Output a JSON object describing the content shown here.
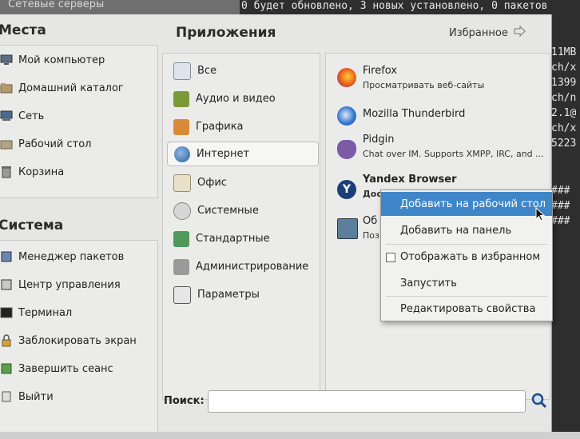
{
  "background": {
    "top_window_title": "Сетевые серверы",
    "terminal_top_line": "0 будет обновлено, 3 новых установлено, 0 пакетов",
    "terminal_right_lines": [
      "11MB",
      "ch/x",
      "1399",
      "ch/n",
      "2.1@",
      "ch/x",
      "5223"
    ],
    "terminal_hash_lines": [
      "###",
      "###",
      "###"
    ]
  },
  "places": {
    "heading": "Места",
    "items": [
      {
        "label": "Мой компьютер",
        "icon": "computer-icon"
      },
      {
        "label": "Домашний каталог",
        "icon": "home-folder-icon"
      },
      {
        "label": "Сеть",
        "icon": "network-icon"
      },
      {
        "label": "Рабочий стол",
        "icon": "desktop-icon"
      },
      {
        "label": "Корзина",
        "icon": "trash-icon"
      }
    ]
  },
  "system": {
    "heading": "Система",
    "items": [
      {
        "label": "Менеджер пакетов",
        "icon": "package-manager-icon"
      },
      {
        "label": "Центр управления",
        "icon": "control-center-icon"
      },
      {
        "label": "Терминал",
        "icon": "terminal-icon"
      },
      {
        "label": "Заблокировать экран",
        "icon": "lock-screen-icon"
      },
      {
        "label": "Завершить сеанс",
        "icon": "logout-icon"
      },
      {
        "label": "Выйти",
        "icon": "quit-icon"
      }
    ]
  },
  "applications": {
    "heading": "Приложения",
    "favorites_label": "Избранное",
    "categories": [
      {
        "label": "Все",
        "icon": "all-apps-icon",
        "selected": false
      },
      {
        "label": "Аудио и видео",
        "icon": "multimedia-icon",
        "selected": false
      },
      {
        "label": "Графика",
        "icon": "graphics-icon",
        "selected": false
      },
      {
        "label": "Интернет",
        "icon": "internet-globe-icon",
        "selected": true
      },
      {
        "label": "Офис",
        "icon": "office-icon",
        "selected": false
      },
      {
        "label": "Системные",
        "icon": "system-gear-icon",
        "selected": false
      },
      {
        "label": "Стандартные",
        "icon": "accessories-icon",
        "selected": false
      },
      {
        "label": "Администрирование",
        "icon": "admin-tools-icon",
        "selected": false
      },
      {
        "label": "Параметры",
        "icon": "preferences-icon",
        "selected": false
      }
    ],
    "apps": [
      {
        "name": "Firefox",
        "desc": "Просматривать веб-сайты",
        "icon": "firefox-icon",
        "bold": false
      },
      {
        "name": "Mozilla Thunderbird",
        "desc": "",
        "icon": "thunderbird-icon",
        "bold": false
      },
      {
        "name": "Pidgin",
        "desc": "Chat over IM.  Supports XMPP, IRC, and ...",
        "icon": "pidgin-icon",
        "bold": false
      },
      {
        "name": "Yandex Browser",
        "desc": "Дос",
        "icon": "yandex-browser-icon",
        "bold": true
      },
      {
        "name": "Об",
        "desc": "Поз",
        "icon": "remote-desktop-icon",
        "bold": false
      }
    ]
  },
  "search": {
    "label": "Поиск:",
    "value": "",
    "placeholder": ""
  },
  "context_menu": {
    "items": [
      {
        "label": "Добавить на рабочий стол",
        "highlighted": true
      },
      {
        "label": "Добавить на панель",
        "highlighted": false
      },
      {
        "label": "Отображать в избранном",
        "checkbox": true,
        "checked": false
      },
      {
        "label": "Запустить",
        "highlighted": false
      },
      {
        "label": "Редактировать свойства",
        "highlighted": false
      }
    ]
  },
  "colors": {
    "highlight": "#3f86c9",
    "menu_bg": "#e6e6e4",
    "terminal_bg": "#2e2e2e"
  }
}
